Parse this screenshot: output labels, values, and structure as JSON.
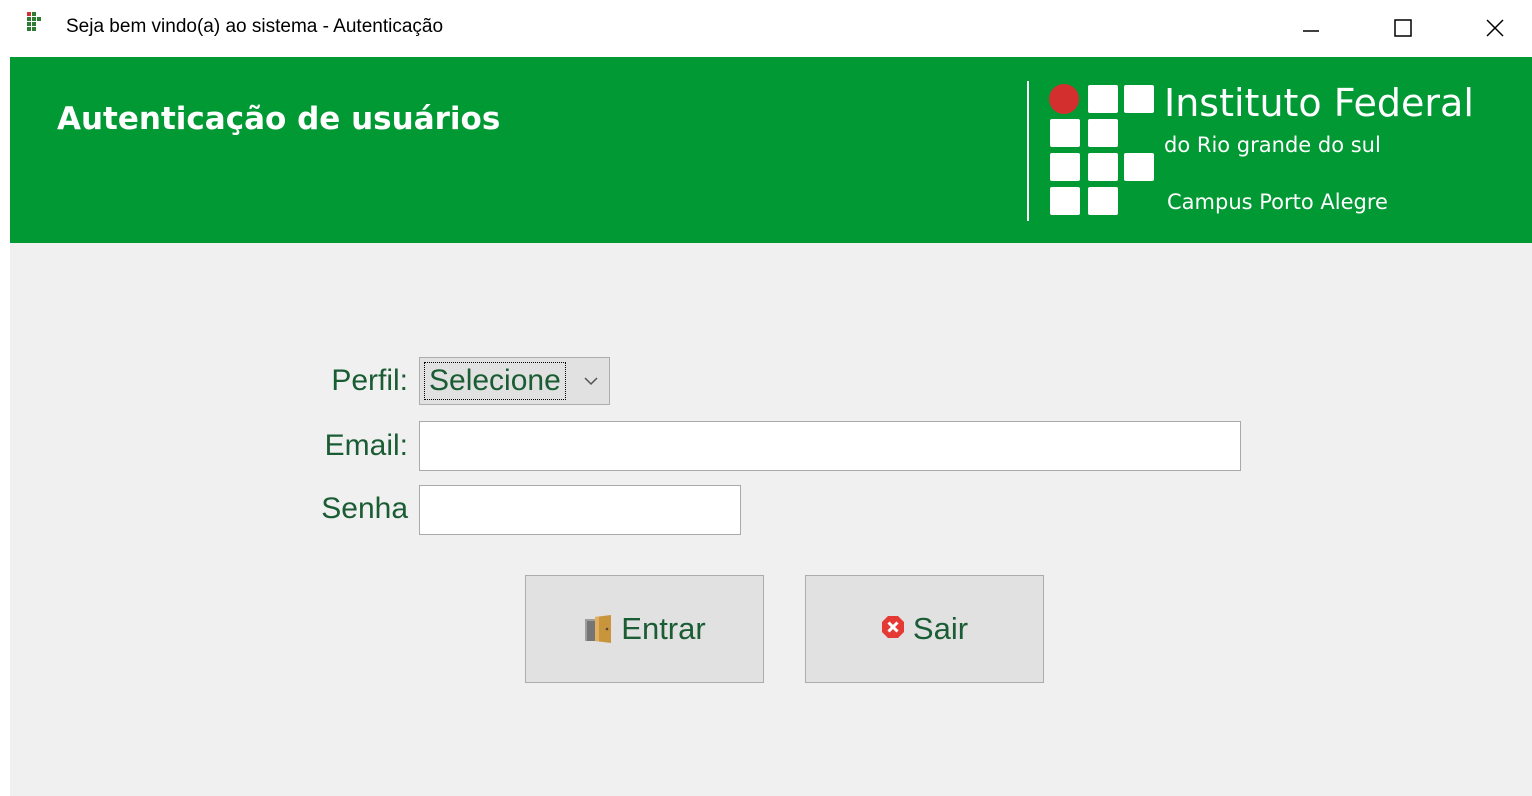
{
  "window": {
    "title": "Seja bem vindo(a) ao sistema - Autenticação",
    "controls": [
      "minimize-icon",
      "maximize-icon",
      "close-icon"
    ]
  },
  "header": {
    "title": "Autenticação de usuários",
    "logo": {
      "name": "Instituto Federal",
      "subtitle": "do Rio grande do sul",
      "campus": "Campus Porto Alegre"
    }
  },
  "form": {
    "perfil": {
      "label": "Perfil:",
      "selected": "Selecione"
    },
    "email": {
      "label": "Email:",
      "value": ""
    },
    "senha": {
      "label": "Senha",
      "value": ""
    }
  },
  "buttons": {
    "entrar": {
      "label": "Entrar",
      "icon": "door-icon"
    },
    "sair": {
      "label": "Sair",
      "icon": "cancel-icon"
    }
  },
  "colors": {
    "header_bg": "#009933",
    "label_text": "#1a5c33",
    "logo_dot": "#d32f2f",
    "content_bg": "#f0f0f0"
  }
}
